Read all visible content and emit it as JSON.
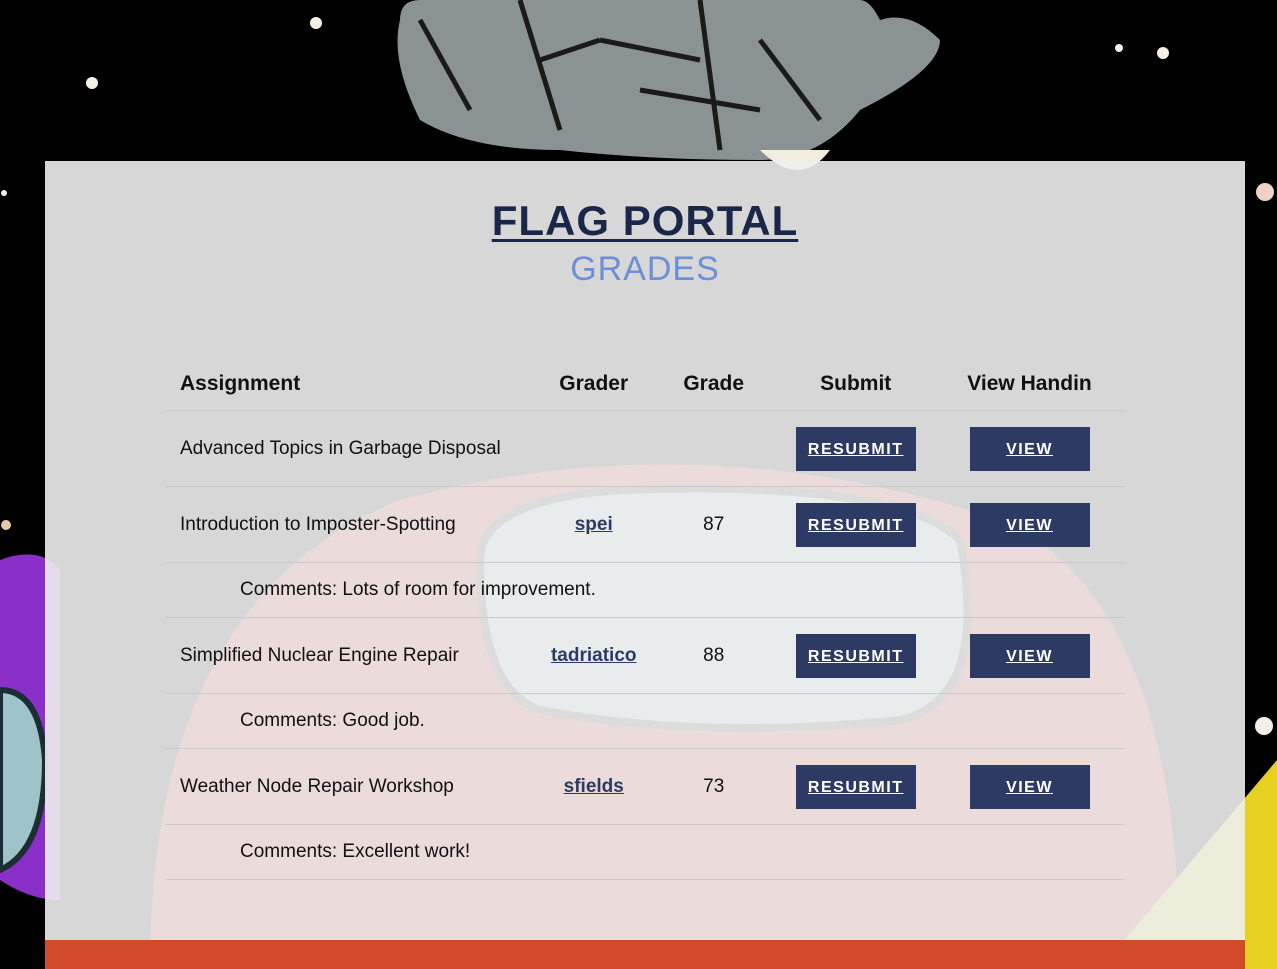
{
  "page": {
    "title": "FLAG PORTAL",
    "subtitle": "GRADES"
  },
  "table": {
    "headers": {
      "assignment": "Assignment",
      "grader": "Grader",
      "grade": "Grade",
      "submit": "Submit",
      "view": "View Handin"
    },
    "rows": [
      {
        "assignment": "Advanced Topics in Garbage Disposal",
        "grader": "",
        "grade": "",
        "submit_label": "RESUBMIT",
        "view_label": "VIEW",
        "comment": ""
      },
      {
        "assignment": "Introduction to Imposter-Spotting",
        "grader": "spei",
        "grade": "87",
        "submit_label": "RESUBMIT",
        "view_label": "VIEW",
        "comment": "Comments: Lots of room for improvement."
      },
      {
        "assignment": "Simplified Nuclear Engine Repair",
        "grader": "tadriatico",
        "grade": "88",
        "submit_label": "RESUBMIT",
        "view_label": "VIEW",
        "comment": "Comments: Good job."
      },
      {
        "assignment": "Weather Node Repair Workshop",
        "grader": "sfields",
        "grade": "73",
        "submit_label": "RESUBMIT",
        "view_label": "VIEW",
        "comment": "Comments: Excellent work!"
      }
    ]
  },
  "colors": {
    "title": "#1b2748",
    "subtitle": "#6d8ed8",
    "button_bg": "#2d3a63",
    "link": "#2c3a66"
  }
}
